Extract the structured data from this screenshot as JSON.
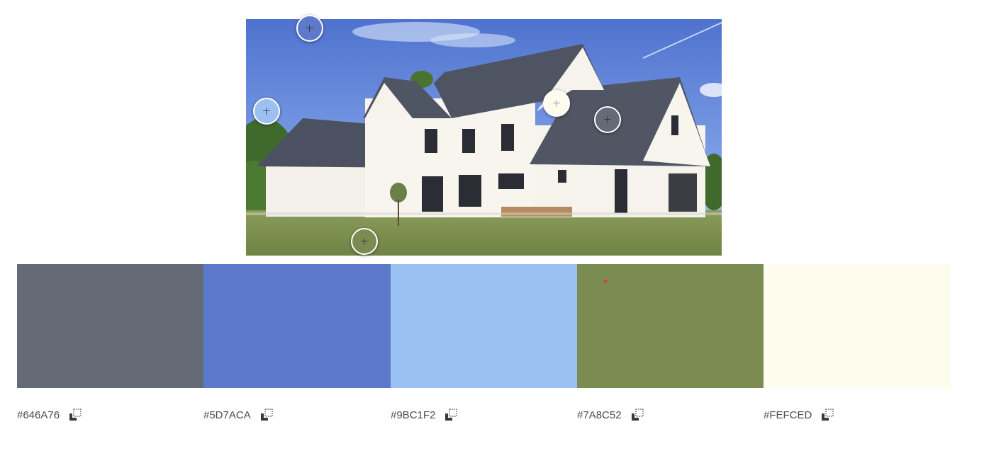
{
  "colors": [
    {
      "hex": "#646A76",
      "label": "#646A76"
    },
    {
      "hex": "#5D7ACA",
      "label": "#5D7ACA"
    },
    {
      "hex": "#9BC1F2",
      "label": "#9BC1F2"
    },
    {
      "hex": "#7A8C52",
      "label": "#7A8C52"
    },
    {
      "hex": "#FEFCED",
      "label": "#FEFCED"
    }
  ],
  "icons": {
    "picker": "plus-icon",
    "copy": "copy-icon"
  }
}
